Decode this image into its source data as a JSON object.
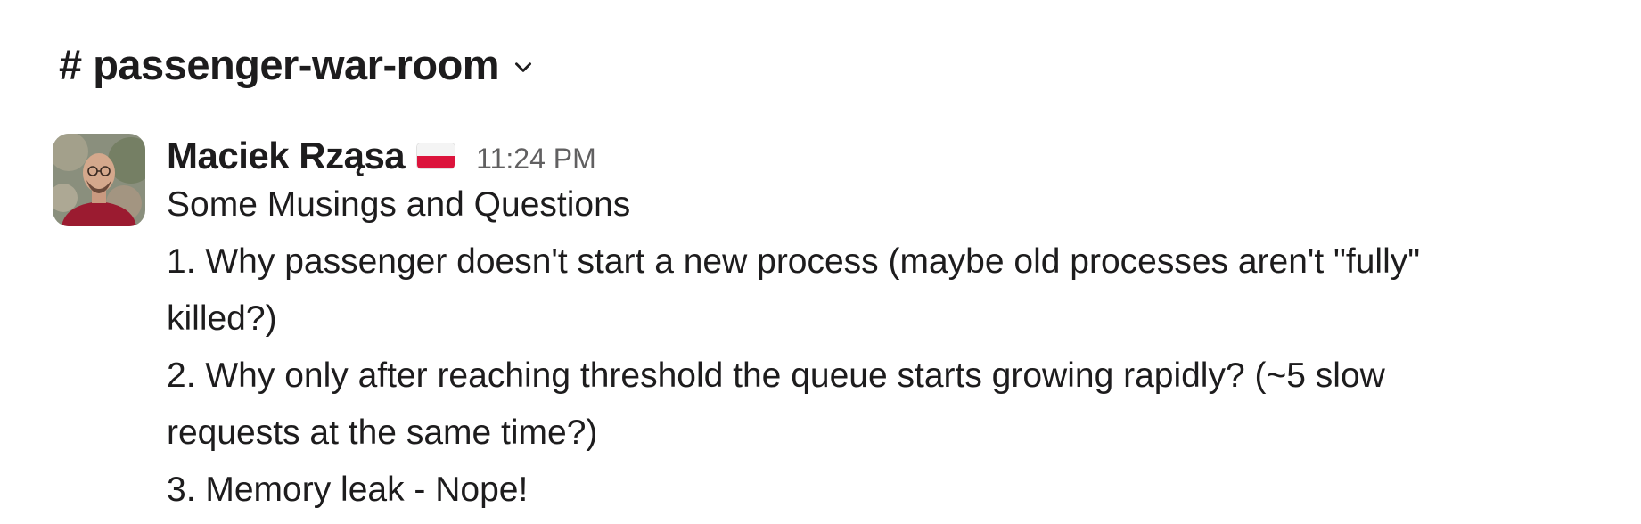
{
  "channel": {
    "name": "# passenger-war-room",
    "dropdown_icon": "chevron-down-icon"
  },
  "message": {
    "author": "Maciek Rząsa",
    "author_flag": "poland-flag-icon",
    "timestamp": "11:24 PM",
    "lines": [
      "Some Musings and Questions",
      "1. Why passenger doesn't start a new process (maybe old processes aren't \"fully\"",
      "killed?)",
      "2. Why only after reaching threshold the queue starts growing rapidly? (~5 slow",
      "requests at the same time?)",
      "3. Memory leak - Nope!"
    ]
  },
  "colors": {
    "text": "#1d1c1d",
    "timestamp": "#616061",
    "avatar_shirt": "#9b1b30",
    "flag_red": "#dc143c"
  }
}
